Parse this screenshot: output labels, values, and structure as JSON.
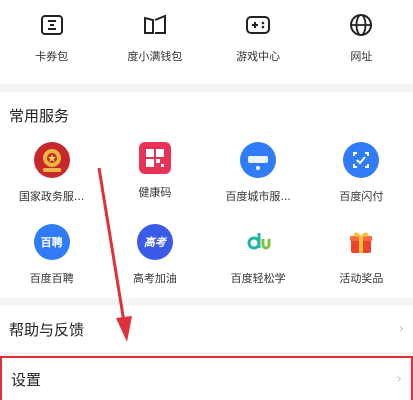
{
  "top_items": [
    {
      "label": "卡券包",
      "icon": "coupon-icon"
    },
    {
      "label": "度小满钱包",
      "icon": "wallet-icon"
    },
    {
      "label": "游戏中心",
      "icon": "gamepad-icon"
    },
    {
      "label": "网址",
      "icon": "globe-icon"
    }
  ],
  "services": {
    "title": "常用服务",
    "items": [
      {
        "label": "国家政务服...",
        "icon": "gov-emblem-icon"
      },
      {
        "label": "健康码",
        "icon": "health-code-icon"
      },
      {
        "label": "百度城市服...",
        "icon": "city-service-icon"
      },
      {
        "label": "百度闪付",
        "icon": "quick-pay-icon"
      },
      {
        "label": "百度百聘",
        "icon": "recruit-icon",
        "text": "百聘"
      },
      {
        "label": "高考加油",
        "icon": "exam-icon",
        "text": "高考"
      },
      {
        "label": "百度轻松学",
        "icon": "easy-learn-icon"
      },
      {
        "label": "活动奖品",
        "icon": "gift-icon"
      }
    ]
  },
  "help": {
    "label": "帮助与反馈"
  },
  "settings": {
    "label": "设置"
  },
  "colors": {
    "highlight": "#e0313a",
    "accent_blue": "#2f7cf6"
  }
}
